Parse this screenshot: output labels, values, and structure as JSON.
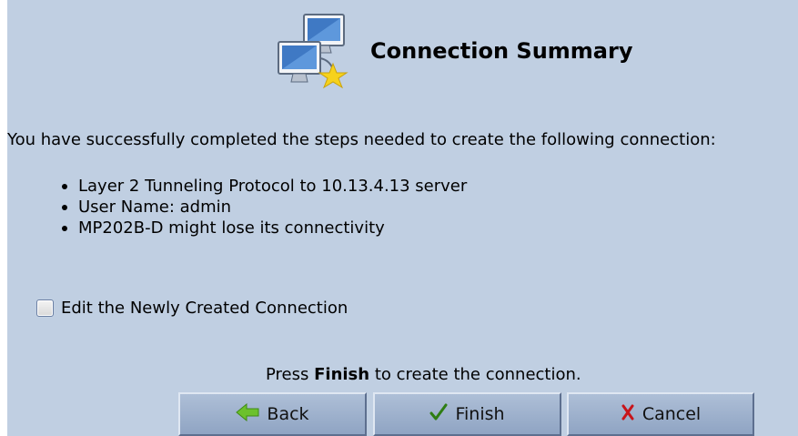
{
  "header": {
    "title": "Connection Summary",
    "icon": "network-computers-star-icon"
  },
  "summary": {
    "intro": "You have successfully completed the steps needed to create the following connection:",
    "items": [
      "Layer 2 Tunneling Protocol to 10.13.4.13 server",
      "User Name: admin",
      "MP202B-D might lose its connectivity"
    ]
  },
  "edit_option": {
    "label": "Edit the Newly Created Connection",
    "checked": false
  },
  "instruction": {
    "prefix": "Press ",
    "bold": "Finish",
    "suffix": " to create the connection."
  },
  "buttons": {
    "back": {
      "label": "Back",
      "icon": "back-arrow-icon"
    },
    "finish": {
      "label": "Finish",
      "icon": "checkmark-icon"
    },
    "cancel": {
      "label": "Cancel",
      "icon": "x-mark-icon"
    }
  },
  "colors": {
    "panel_background": "#c0cfe2",
    "button_face": "#9fb2cd",
    "back_arrow": "#6cc12c",
    "finish_check": "#2e7d13",
    "cancel_x": "#c8141a"
  }
}
